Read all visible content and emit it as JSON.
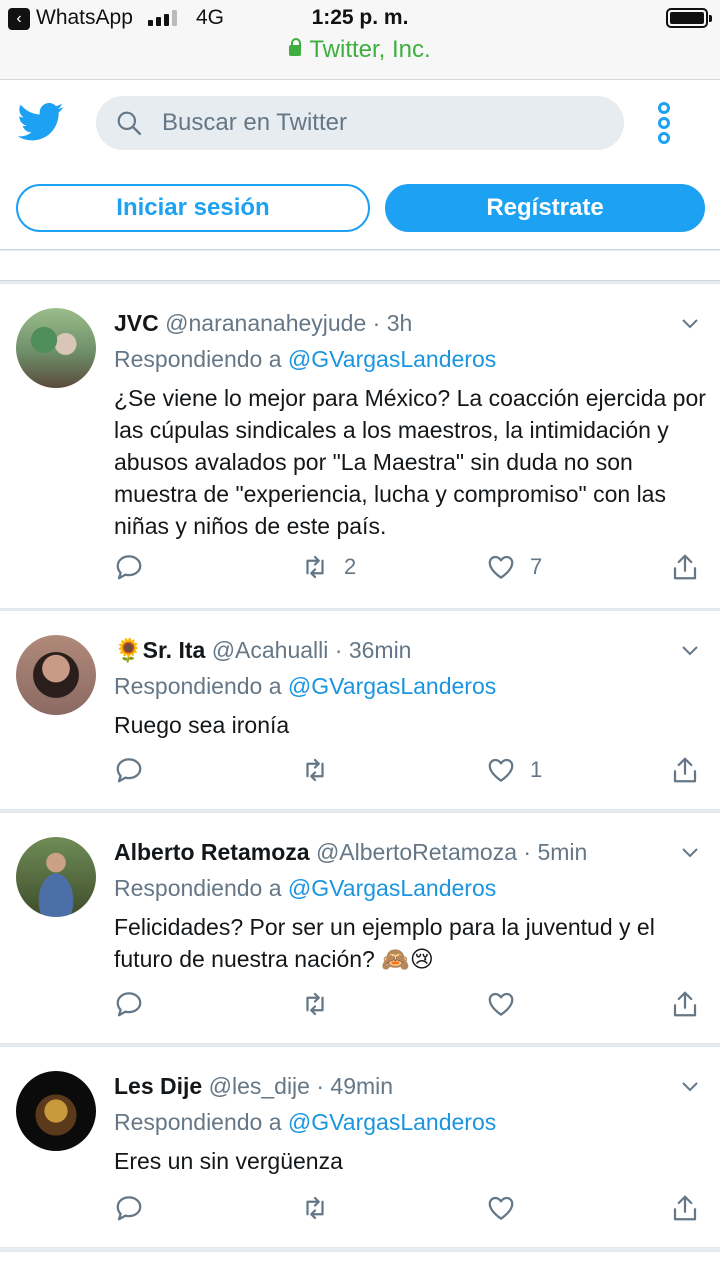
{
  "status_bar": {
    "back_app": "WhatsApp",
    "network": "4G",
    "time": "1:25 p. m.",
    "url": "Twitter, Inc."
  },
  "header": {
    "search_placeholder": "Buscar en Twitter",
    "login_label": "Iniciar sesión",
    "signup_label": "Regístrate"
  },
  "colors": {
    "accent": "#1da1f2",
    "muted": "#657786",
    "secure_green": "#3eaf3e"
  },
  "tweets": [
    {
      "name": "JVC",
      "handle": "@narananaheyjude",
      "time": "3h",
      "reply_prefix": "Respondiendo a",
      "reply_to": "@GVargasLanderos",
      "text": "¿Se viene lo mejor para México? La coacción ejercida por las cúpulas sindicales a los maestros, la intimidación y abusos avalados por \"La Maestra\" sin duda no son muestra de \"experiencia, lucha y compromiso\" con las niñas y niños de este país.",
      "retweets": "2",
      "likes": "7"
    },
    {
      "name_emoji": "🌻",
      "name": "Sr. Ita",
      "handle": "@Acahualli",
      "time": "36min",
      "reply_prefix": "Respondiendo a",
      "reply_to": "@GVargasLanderos",
      "text": "Ruego sea ironía",
      "retweets": "",
      "likes": "1"
    },
    {
      "name": "Alberto Retamoza",
      "handle": "@AlbertoRetamoza",
      "time": "5min",
      "reply_prefix": "Respondiendo a",
      "reply_to": "@GVargasLanderos",
      "text": "Felicidades? Por ser un ejemplo para la juventud y el futuro de nuestra nación? 🙈😢",
      "retweets": "",
      "likes": ""
    },
    {
      "name": "Les Dije",
      "handle": "@les_dije",
      "time": "49min",
      "reply_prefix": "Respondiendo a",
      "reply_to": "@GVargasLanderos",
      "text": "Eres un sin vergüenza",
      "retweets": "",
      "likes": ""
    }
  ]
}
